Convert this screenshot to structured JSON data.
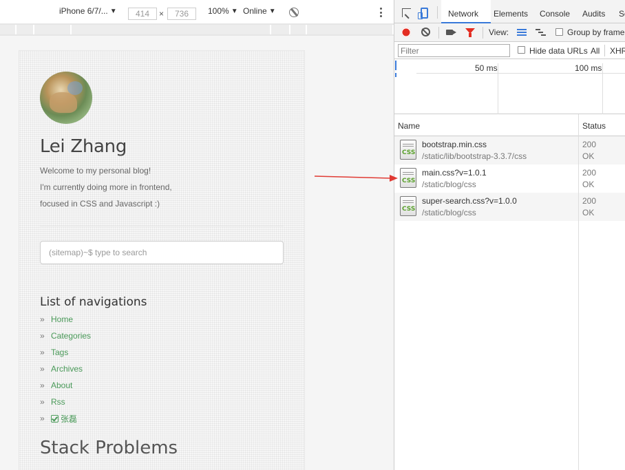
{
  "device_toolbar": {
    "device": "iPhone 6/7/...",
    "width": "414",
    "times": "×",
    "height": "736",
    "zoom": "100%",
    "network": "Online"
  },
  "page": {
    "title": "Lei Zhang",
    "bio": [
      "Welcome to my personal blog!",
      "I'm currently doing more in frontend,",
      "focused in CSS and Javascript :)"
    ],
    "search_placeholder": "(sitemap)~$ type to search",
    "nav_heading": "List of navigations",
    "nav_bullet": "»",
    "nav_items": [
      "Home",
      "Categories",
      "Tags",
      "Archives",
      "About",
      "Rss",
      "张磊"
    ],
    "section_title": "Stack Problems",
    "link_color": "#4a9a59"
  },
  "devtools": {
    "tabs": [
      "Network",
      "Elements",
      "Console",
      "Audits",
      "So"
    ],
    "active_tab": "Network",
    "view_label": "View:",
    "group_by_frame": "Group by frame",
    "filter_placeholder": "Filter",
    "hide_data_urls": "Hide data URLs",
    "all": "All",
    "xhr": "XHR",
    "timeline_labels": [
      "50 ms",
      "100 ms"
    ],
    "columns": [
      "Name",
      "Status"
    ],
    "rows": [
      {
        "name": "bootstrap.min.css",
        "path": "/static/lib/bootstrap-3.3.7/css",
        "status": "200",
        "status_text": "OK",
        "icon": "CSS"
      },
      {
        "name": "main.css?v=1.0.1",
        "path": "/static/blog/css",
        "status": "200",
        "status_text": "OK",
        "icon": "CSS"
      },
      {
        "name": "super-search.css?v=1.0.0",
        "path": "/static/blog/css",
        "status": "200",
        "status_text": "OK",
        "icon": "CSS"
      }
    ],
    "record_color": "#e32d22",
    "accent_color": "#3879d9"
  },
  "annotation_arrow_color": "#e03a33"
}
